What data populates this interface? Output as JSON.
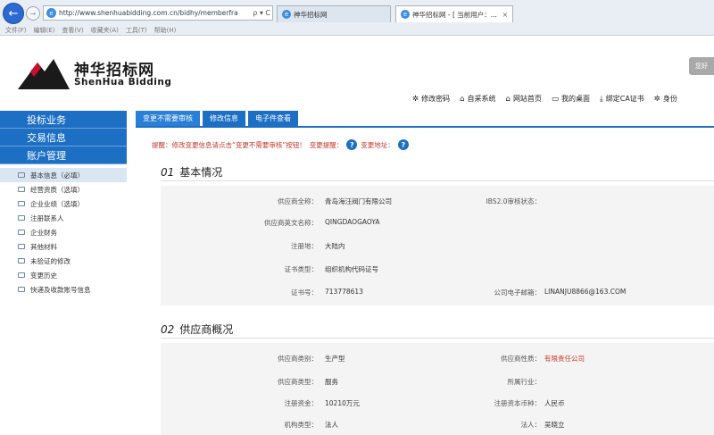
{
  "browser": {
    "url": "http://www.shenhuabidding.com.cn/bidhy/memberfra",
    "address_controls": "ρ ▾ C",
    "tabs": [
      {
        "title": "神华招标网"
      },
      {
        "title": "神华招标网 - [ 当前用户：..."
      }
    ],
    "menu": [
      "文件(F)",
      "编辑(E)",
      "查看(V)",
      "收藏夹(A)",
      "工具(T)",
      "帮助(H)"
    ]
  },
  "header": {
    "brand_cn": "神华招标网",
    "brand_en": "ShenHua Bidding",
    "greeting": "您好",
    "links": [
      {
        "icon": "gear-icon",
        "glyph": "✲",
        "label": "修改密码"
      },
      {
        "icon": "home-icon",
        "glyph": "⌂",
        "label": "自采系统"
      },
      {
        "icon": "home-icon",
        "glyph": "⌂",
        "label": "网站首页"
      },
      {
        "icon": "monitor-icon",
        "glyph": "▭",
        "label": "我的桌面"
      },
      {
        "icon": "download-icon",
        "glyph": "⤓",
        "label": "绑定CA证书"
      },
      {
        "icon": "gear-icon",
        "glyph": "✲",
        "label": "身份"
      }
    ]
  },
  "sidebar": {
    "categories": [
      "投标业务",
      "交易信息",
      "账户管理"
    ],
    "items": [
      "基本信息（必填）",
      "经营资质（选填）",
      "企业业绩（选填）",
      "注册联系人",
      "企业财务",
      "其他材料",
      "未验证的修改",
      "变更历史",
      "快递及收款账号信息"
    ]
  },
  "main": {
    "tabs": [
      "变更不需要审核",
      "修改信息",
      "电子件查看"
    ],
    "notice": "提醒：修改变更信息请点击“变更不需要审核”按钮！",
    "notice_link1": "变更提醒：",
    "notice_link2": "变更地址：",
    "section1": {
      "num": "01",
      "title": "基本情况",
      "labels": {
        "company_name": "供应商全称：",
        "ibs_status": "IBS2.0审核状态：",
        "english_name": "供应商英文名称：",
        "reg_place": "注册地：",
        "cert_type": "证书类型：",
        "cert_no": "证书号：",
        "email": "公司电子邮箱："
      },
      "values": {
        "company_name": "青岛海汪阀门有限公司",
        "ibs_status": "",
        "english_name": "QINGDAOGAOYA",
        "reg_place": "大陆内",
        "cert_type": "组织机构代码证号",
        "cert_no": "713778613",
        "email": "LINANJU8866@163.COM"
      }
    },
    "section2": {
      "num": "02",
      "title": "供应商概况",
      "labels": {
        "supplier_category": "供应商类别：",
        "supplier_nature": "供应商性质：",
        "supplier_type": "供应商类型：",
        "industry": "所属行业：",
        "reg_capital": "注册资金：",
        "currency": "注册资本币种：",
        "org_type": "机构类型：",
        "legal_rep": "法人："
      },
      "values": {
        "supplier_category": "生产型",
        "supplier_nature": "有限责任公司",
        "supplier_type": "服务",
        "industry": "",
        "reg_capital": "10210万元",
        "currency": "人民币",
        "org_type": "法人",
        "legal_rep": "吴晓立"
      }
    }
  },
  "colors": {
    "accent": "#1d6fc4",
    "alert": "#c0392b",
    "panel": "#f4f4f4"
  }
}
